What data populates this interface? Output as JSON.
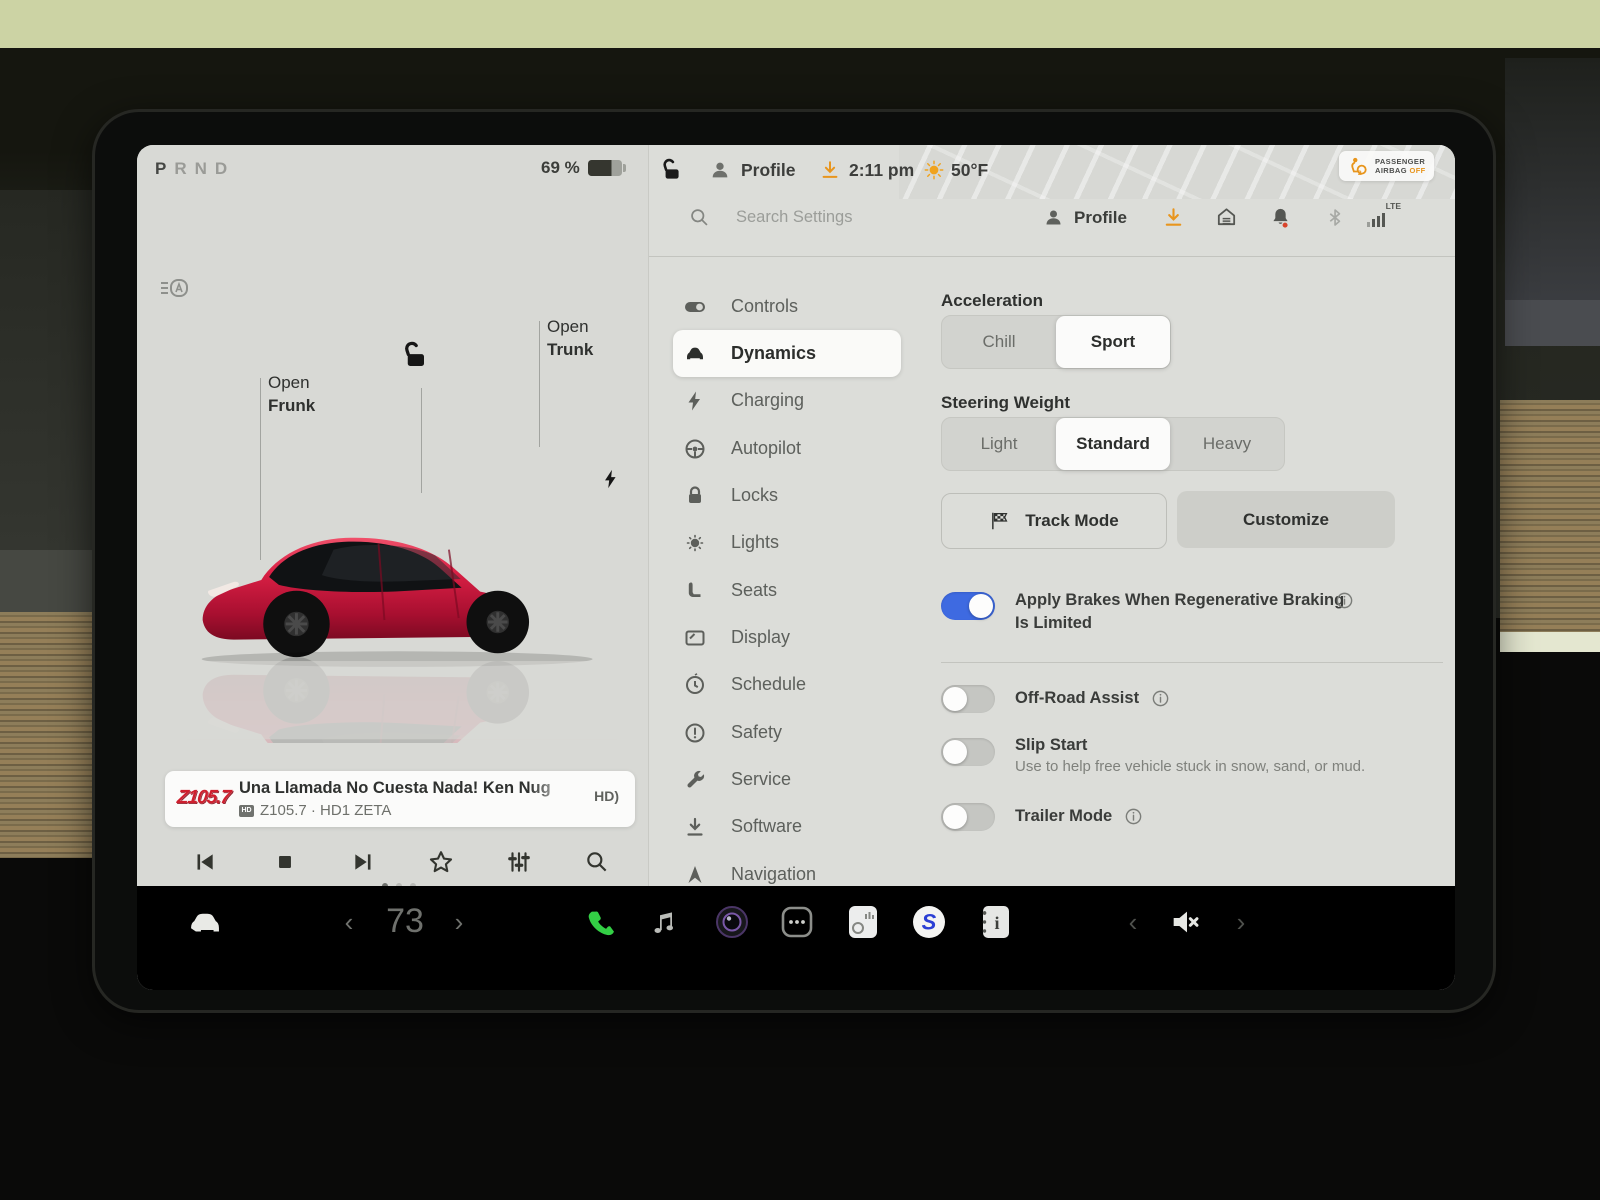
{
  "status_bar": {
    "gears": [
      "P",
      "R",
      "N",
      "D"
    ],
    "selected_gear": "P",
    "battery_percent": "69 %",
    "profile_label": "Profile",
    "time": "2:11 pm",
    "outside_temp": "50°F",
    "airbag_badge": {
      "line1": "PASSENGER",
      "line2": "AIRBAG ",
      "status": "OFF"
    }
  },
  "vehicle_panel": {
    "open_frunk_label_1": "Open",
    "open_frunk_label_2": "Frunk",
    "open_trunk_label_1": "Open",
    "open_trunk_label_2": "Trunk",
    "media": {
      "station_logo": "Z105.7",
      "track_title": "Una Llamada No Cuesta Nada! Ken Nug",
      "station_line": "Z105.7 · HD1 ZETA",
      "hd_mini_badge": "HD",
      "hd_radio_badge": "HD)"
    }
  },
  "settings": {
    "search_placeholder": "Search Settings",
    "profile_label": "Profile",
    "network_label": "LTE",
    "sidebar": [
      {
        "icon": "toggle-icon",
        "label": "Controls"
      },
      {
        "icon": "car-icon",
        "label": "Dynamics"
      },
      {
        "icon": "bolt-icon",
        "label": "Charging"
      },
      {
        "icon": "steering-wheel-icon",
        "label": "Autopilot"
      },
      {
        "icon": "lock-icon",
        "label": "Locks"
      },
      {
        "icon": "light-icon",
        "label": "Lights"
      },
      {
        "icon": "seat-icon",
        "label": "Seats"
      },
      {
        "icon": "display-icon",
        "label": "Display"
      },
      {
        "icon": "clock-icon",
        "label": "Schedule"
      },
      {
        "icon": "alert-icon",
        "label": "Safety"
      },
      {
        "icon": "wrench-icon",
        "label": "Service"
      },
      {
        "icon": "download-icon",
        "label": "Software"
      },
      {
        "icon": "navigation-icon",
        "label": "Navigation"
      }
    ],
    "selected_tab": "Dynamics",
    "dynamics": {
      "acceleration_label": "Acceleration",
      "acceleration_options": [
        "Chill",
        "Sport"
      ],
      "acceleration_selected": "Sport",
      "steering_label": "Steering Weight",
      "steering_options": [
        "Light",
        "Standard",
        "Heavy"
      ],
      "steering_selected": "Standard",
      "track_mode_label": "Track Mode",
      "customize_label": "Customize",
      "toggles": [
        {
          "label": "Apply Brakes When Regenerative Braking Is Limited",
          "state": "on"
        },
        {
          "label": "Off-Road Assist",
          "state": "off"
        },
        {
          "label": "Slip Start",
          "description": "Use to help free vehicle stuck in snow, sand, or mud.",
          "state": "off"
        },
        {
          "label": "Trailer Mode",
          "state": "off"
        }
      ]
    }
  },
  "dock": {
    "cabin_temp": "73",
    "volume_muted": true
  }
}
